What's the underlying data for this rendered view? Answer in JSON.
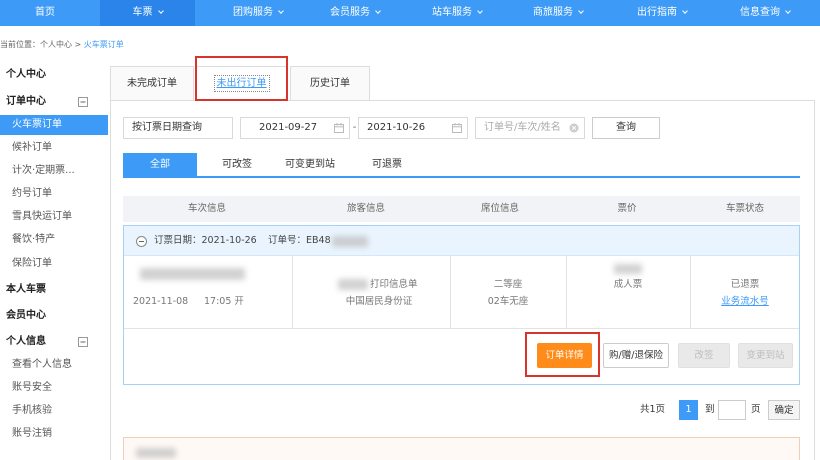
{
  "colors": {
    "primary": "#3d9bf7",
    "nav_active": "#2a84ea",
    "details_button": "#ff8c1a",
    "annotation_box": "#d9342b"
  },
  "nav": {
    "items": [
      {
        "label": "首页",
        "has_dropdown": false
      },
      {
        "label": "车票",
        "has_dropdown": true,
        "active": true
      },
      {
        "label": "团购服务",
        "has_dropdown": true
      },
      {
        "label": "会员服务",
        "has_dropdown": true
      },
      {
        "label": "站车服务",
        "has_dropdown": true
      },
      {
        "label": "商旅服务",
        "has_dropdown": true
      },
      {
        "label": "出行指南",
        "has_dropdown": true
      },
      {
        "label": "信息查询",
        "has_dropdown": true
      }
    ]
  },
  "breadcrumb": {
    "prefix": "当前位置：个人中心 > ",
    "current": "火车票订单"
  },
  "sidebar": {
    "items": [
      {
        "label": "个人中心",
        "type": "header"
      },
      {
        "label": "订单中心",
        "type": "group",
        "icon": "collapse-icon"
      },
      {
        "label": "火车票订单",
        "type": "item",
        "active": true
      },
      {
        "label": "候补订单",
        "type": "item"
      },
      {
        "label": "计次·定期票...",
        "type": "item"
      },
      {
        "label": "约号订单",
        "type": "item"
      },
      {
        "label": "雪具快运订单",
        "type": "item"
      },
      {
        "label": "餐饮·特产",
        "type": "item"
      },
      {
        "label": "保险订单",
        "type": "item"
      },
      {
        "label": "本人车票",
        "type": "header"
      },
      {
        "label": "会员中心",
        "type": "header"
      },
      {
        "label": "个人信息",
        "type": "group",
        "icon": "collapse-icon"
      },
      {
        "label": "查看个人信息",
        "type": "item"
      },
      {
        "label": "账号安全",
        "type": "item"
      },
      {
        "label": "手机核验",
        "type": "item"
      },
      {
        "label": "账号注销",
        "type": "item"
      }
    ]
  },
  "order_tabs": {
    "items": [
      {
        "label": "未完成订单"
      },
      {
        "label": "未出行订单",
        "active": true
      },
      {
        "label": "历史订单"
      }
    ]
  },
  "filter": {
    "query_type": "按订票日期查询",
    "date_from": "2021-09-27",
    "date_separator": "-",
    "date_to": "2021-10-26",
    "search_placeholder": "订单号/车次/姓名",
    "search_button": "查询"
  },
  "status_tabs": {
    "items": [
      {
        "label": "全部",
        "active": true
      },
      {
        "label": "可改签"
      },
      {
        "label": "可变更到站"
      },
      {
        "label": "可退票"
      }
    ]
  },
  "table": {
    "headers": [
      "车次信息",
      "旅客信息",
      "席位信息",
      "票价",
      "车票状态"
    ]
  },
  "order": {
    "booking_date_label": "订票日期：",
    "booking_date": "2021-10-26",
    "order_no_label": "订单号：",
    "order_no_visible": "EB48",
    "train": {
      "date": "2021-11-08",
      "depart_time": "17:05 开"
    },
    "passenger": {
      "print_label": "打印信息单",
      "id_type": "中国居民身份证"
    },
    "seat": {
      "seat_class": "二等座",
      "seat_no": "02车无座"
    },
    "price": {
      "ticket_type": "成人票"
    },
    "status": {
      "state": "已退票",
      "serial_link": "业务流水号"
    }
  },
  "actions": {
    "details": "订单详情",
    "insurance": "购/赠/退保险",
    "change": "改签",
    "change_station": "变更到站"
  },
  "pagination": {
    "total": "共1页",
    "current_page": "1",
    "goto_label": "到",
    "page_unit": "页",
    "page_input_value": "",
    "confirm": "确定"
  }
}
